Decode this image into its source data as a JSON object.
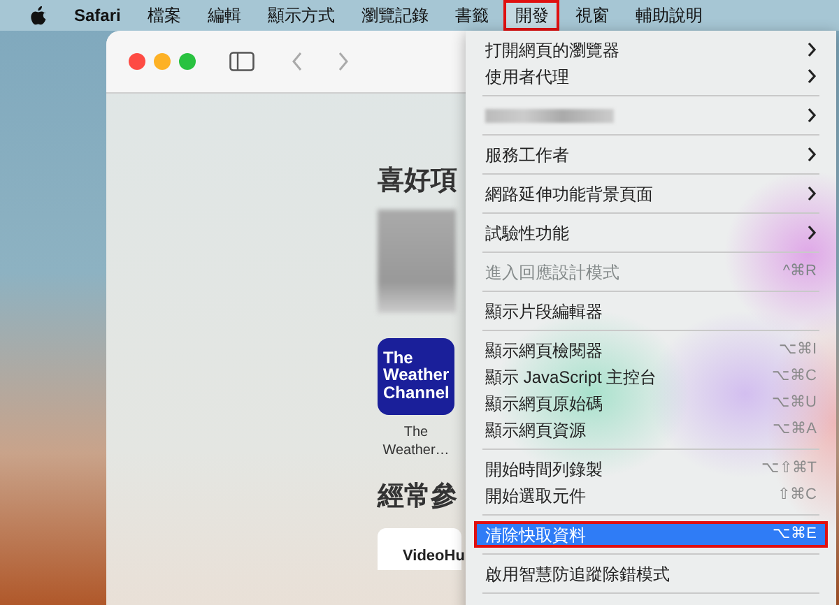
{
  "menubar": {
    "items": [
      {
        "kind": "apple",
        "selected": false,
        "highlighted": false
      },
      {
        "kind": "app",
        "label": "Safari",
        "selected": false,
        "highlighted": false
      },
      {
        "kind": "menu",
        "label": "檔案",
        "selected": false,
        "highlighted": false
      },
      {
        "kind": "menu",
        "label": "編輯",
        "selected": false,
        "highlighted": false
      },
      {
        "kind": "menu",
        "label": "顯示方式",
        "selected": false,
        "highlighted": false
      },
      {
        "kind": "menu",
        "label": "瀏覽記錄",
        "selected": false,
        "highlighted": false
      },
      {
        "kind": "menu",
        "label": "書籤",
        "selected": false,
        "highlighted": false
      },
      {
        "kind": "menu",
        "label": "開發",
        "selected": true,
        "highlighted": true
      },
      {
        "kind": "menu",
        "label": "視窗",
        "selected": false,
        "highlighted": false
      },
      {
        "kind": "menu",
        "label": "輔助說明",
        "selected": false,
        "highlighted": false
      }
    ]
  },
  "browser_window": {
    "favorites_heading": "喜好項",
    "favorites": [
      {
        "kind": "blurred"
      },
      {
        "kind": "tile",
        "logo_text": "The Weather Channel",
        "label": "The Weather…"
      }
    ],
    "frequent_heading": "經常參",
    "frequent": [
      {
        "label": "VideoHu"
      }
    ]
  },
  "menu": {
    "items": [
      {
        "kind": "item",
        "label": "打開網頁的瀏覽器",
        "submenu": true,
        "disabled": false,
        "selected": false,
        "highlighted": false
      },
      {
        "kind": "item",
        "label": "使用者代理",
        "submenu": true,
        "disabled": false,
        "selected": false,
        "highlighted": false
      },
      {
        "kind": "separator"
      },
      {
        "kind": "blurred",
        "submenu": true
      },
      {
        "kind": "separator"
      },
      {
        "kind": "item",
        "label": "服務工作者",
        "submenu": true,
        "disabled": false,
        "selected": false,
        "highlighted": false
      },
      {
        "kind": "separator"
      },
      {
        "kind": "item",
        "label": "網路延伸功能背景頁面",
        "submenu": true,
        "disabled": false,
        "selected": false,
        "highlighted": false
      },
      {
        "kind": "separator"
      },
      {
        "kind": "item",
        "label": "試驗性功能",
        "submenu": true,
        "disabled": false,
        "selected": false,
        "highlighted": false
      },
      {
        "kind": "separator"
      },
      {
        "kind": "item",
        "label": "進入回應設計模式",
        "shortcut": "^⌘R",
        "submenu": false,
        "disabled": true,
        "selected": false,
        "highlighted": false
      },
      {
        "kind": "separator"
      },
      {
        "kind": "item",
        "label": "顯示片段編輯器",
        "submenu": false,
        "disabled": false,
        "selected": false,
        "highlighted": false
      },
      {
        "kind": "separator"
      },
      {
        "kind": "item",
        "label": "顯示網頁檢閱器",
        "shortcut": "⌥⌘I",
        "submenu": false,
        "disabled": false,
        "selected": false,
        "highlighted": false
      },
      {
        "kind": "item",
        "label": "顯示 JavaScript 主控台",
        "shortcut": "⌥⌘C",
        "submenu": false,
        "disabled": false,
        "selected": false,
        "highlighted": false
      },
      {
        "kind": "item",
        "label": "顯示網頁原始碼",
        "shortcut": "⌥⌘U",
        "submenu": false,
        "disabled": false,
        "selected": false,
        "highlighted": false
      },
      {
        "kind": "item",
        "label": "顯示網頁資源",
        "shortcut": "⌥⌘A",
        "submenu": false,
        "disabled": false,
        "selected": false,
        "highlighted": false
      },
      {
        "kind": "separator"
      },
      {
        "kind": "item",
        "label": "開始時間列錄製",
        "shortcut": "⌥⇧⌘T",
        "submenu": false,
        "disabled": false,
        "selected": false,
        "highlighted": false
      },
      {
        "kind": "item",
        "label": "開始選取元件",
        "shortcut": "⇧⌘C",
        "submenu": false,
        "disabled": false,
        "selected": false,
        "highlighted": false
      },
      {
        "kind": "separator"
      },
      {
        "kind": "item",
        "label": "清除快取資料",
        "shortcut": "⌥⌘E",
        "submenu": false,
        "disabled": false,
        "selected": true,
        "highlighted": true
      },
      {
        "kind": "separator"
      },
      {
        "kind": "item",
        "label": "啟用智慧防追蹤除錯模式",
        "submenu": false,
        "disabled": false,
        "selected": false,
        "highlighted": false
      },
      {
        "kind": "separator"
      }
    ]
  }
}
